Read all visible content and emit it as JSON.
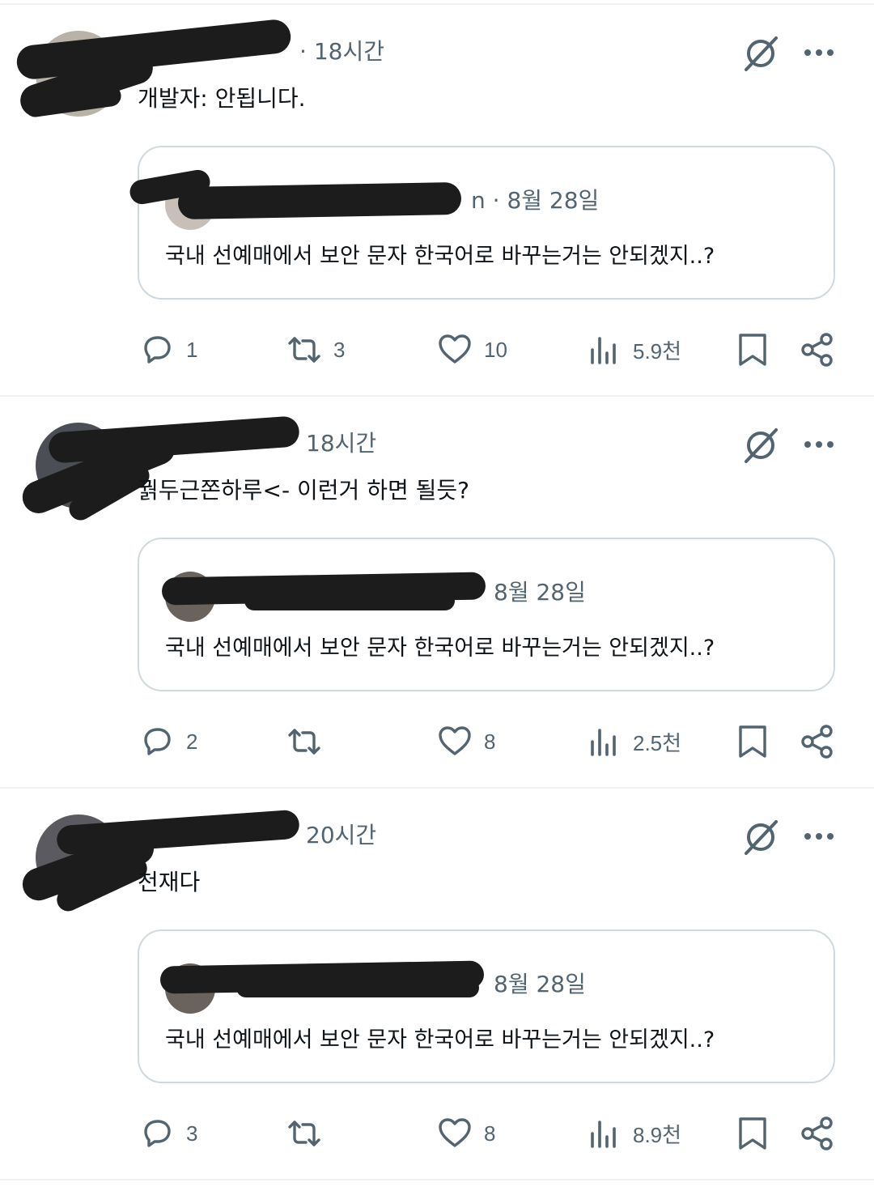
{
  "posts": [
    {
      "time": "18시간",
      "text": "개발자: 안됩니다.",
      "quote": {
        "date": "8월 28일",
        "text": "국내 선예매에서 보안 문자 한국어로 바꾸는거는 안되겠지..?"
      },
      "stats": {
        "replies": "1",
        "reposts": "3",
        "likes": "10",
        "views": "5.9천"
      }
    },
    {
      "time": "18시간",
      "text": "꿝두근쫀하루<- 이런거 하면 될듯?",
      "quote": {
        "date": "8월 28일",
        "text": "국내 선예매에서 보안 문자 한국어로 바꾸는거는 안되겠지..?"
      },
      "stats": {
        "replies": "2",
        "reposts": "",
        "likes": "8",
        "views": "2.5천"
      }
    },
    {
      "time": "20시간",
      "text": "천재다",
      "quote": {
        "date": "8월 28일",
        "text": "국내 선예매에서 보안 문자 한국어로 바꾸는거는 안되겠지..?"
      },
      "stats": {
        "replies": "3",
        "reposts": "",
        "likes": "8",
        "views": "8.9천"
      }
    }
  ],
  "icons": {
    "grok": "grok-icon",
    "more": "more-dots-icon",
    "reply": "reply-bubble-icon",
    "repost": "repost-arrows-icon",
    "like": "heart-icon",
    "views": "views-bars-icon",
    "bookmark": "bookmark-icon",
    "share": "share-icon"
  },
  "colors": {
    "text": "#0f1419",
    "secondary": "#536471",
    "border": "#cfd9de",
    "divider": "#eff3f4"
  }
}
